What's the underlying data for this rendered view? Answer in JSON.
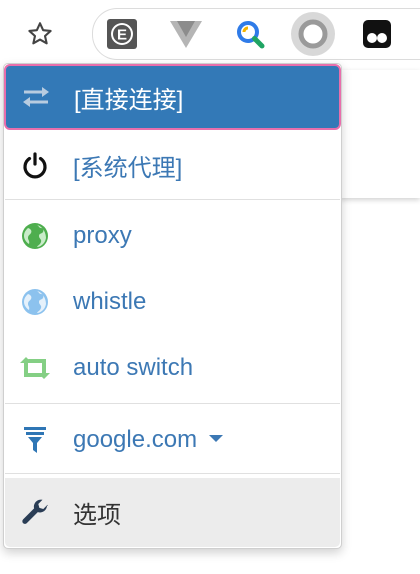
{
  "toolbar": {
    "bookmark_icon": "star-outline-icon",
    "extensions": [
      {
        "name": "ext-e-icon",
        "color": "#555555"
      },
      {
        "name": "ext-v-icon",
        "color": "#9a9a9a"
      },
      {
        "name": "ext-search-icon",
        "color": "#2f7be8"
      },
      {
        "name": "switchyomega-icon",
        "color": "#8a8a8a",
        "active": true
      },
      {
        "name": "ext-tamper-icon",
        "color": "#111111"
      }
    ]
  },
  "menu": {
    "items": [
      {
        "id": "direct",
        "label": "[直接连接]",
        "icon": "swap-arrows-icon",
        "selected": true
      },
      {
        "id": "system",
        "label": "[系统代理]",
        "icon": "power-icon"
      },
      {
        "id": "proxy",
        "label": "proxy",
        "icon": "globe-green-icon",
        "color": "#4eae4e"
      },
      {
        "id": "whistle",
        "label": "whistle",
        "icon": "globe-blue-icon",
        "color": "#8cc2ee"
      },
      {
        "id": "auto",
        "label": "auto switch",
        "icon": "retweet-icon",
        "color": "#84cf84"
      },
      {
        "id": "rule",
        "label": "google.com",
        "icon": "filter-icon",
        "color": "#2f76b5"
      },
      {
        "id": "options",
        "label": "选项",
        "icon": "wrench-icon"
      }
    ],
    "colors": {
      "accent": "#3379b7",
      "highlight_border": "#e86fac",
      "link": "#3c78b4"
    }
  }
}
